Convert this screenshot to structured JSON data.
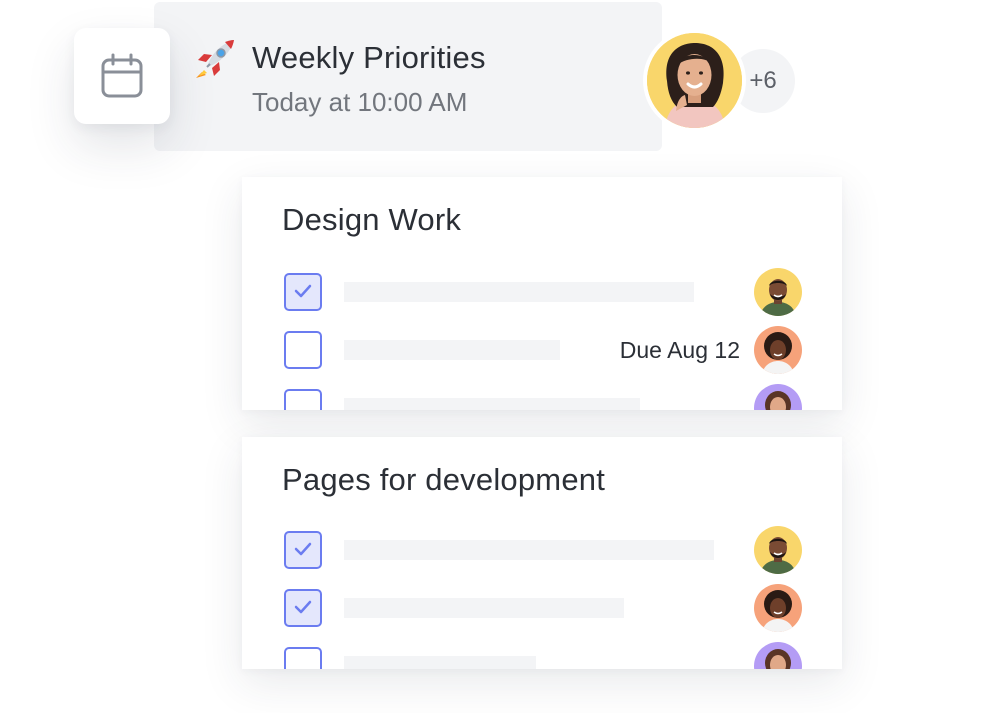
{
  "event": {
    "title": "Weekly Priorities",
    "time": "Today at 10:00 AM",
    "attendees_more": "+6",
    "icon": "rocket-emoji"
  },
  "lists": [
    {
      "title": "Design Work",
      "tasks": [
        {
          "checked": true,
          "due": ""
        },
        {
          "checked": false,
          "due": "Due Aug 12"
        },
        {
          "checked": false,
          "due": ""
        }
      ]
    },
    {
      "title": "Pages for development",
      "tasks": [
        {
          "checked": true,
          "due": ""
        },
        {
          "checked": true,
          "due": ""
        },
        {
          "checked": false,
          "due": ""
        }
      ]
    }
  ],
  "colors": {
    "accent": "#6b7cf0",
    "checked_fill": "#e4e7fc",
    "placeholder": "#f3f4f6",
    "avatar_yellow": "#f9d66b",
    "avatar_orange": "#f6a27a",
    "avatar_purple": "#b49cf5"
  }
}
